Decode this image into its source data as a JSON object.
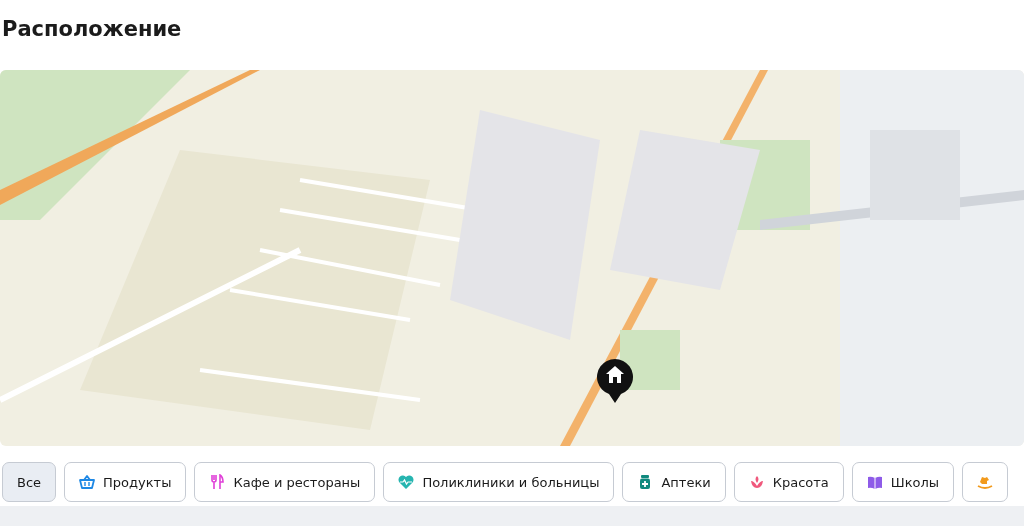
{
  "title": "Расположение",
  "filters": [
    {
      "kind": "all",
      "label": "Все",
      "selected": true
    },
    {
      "kind": "groceries",
      "label": "Продукты",
      "selected": false
    },
    {
      "kind": "cafe",
      "label": "Кафе и рестораны",
      "selected": false
    },
    {
      "kind": "clinic",
      "label": "Поликлиники и больницы",
      "selected": false
    },
    {
      "kind": "pharmacy",
      "label": "Аптеки",
      "selected": false
    },
    {
      "kind": "beauty",
      "label": "Красота",
      "selected": false
    },
    {
      "kind": "school",
      "label": "Школы",
      "selected": false
    },
    {
      "kind": "kids",
      "selected": false
    }
  ]
}
